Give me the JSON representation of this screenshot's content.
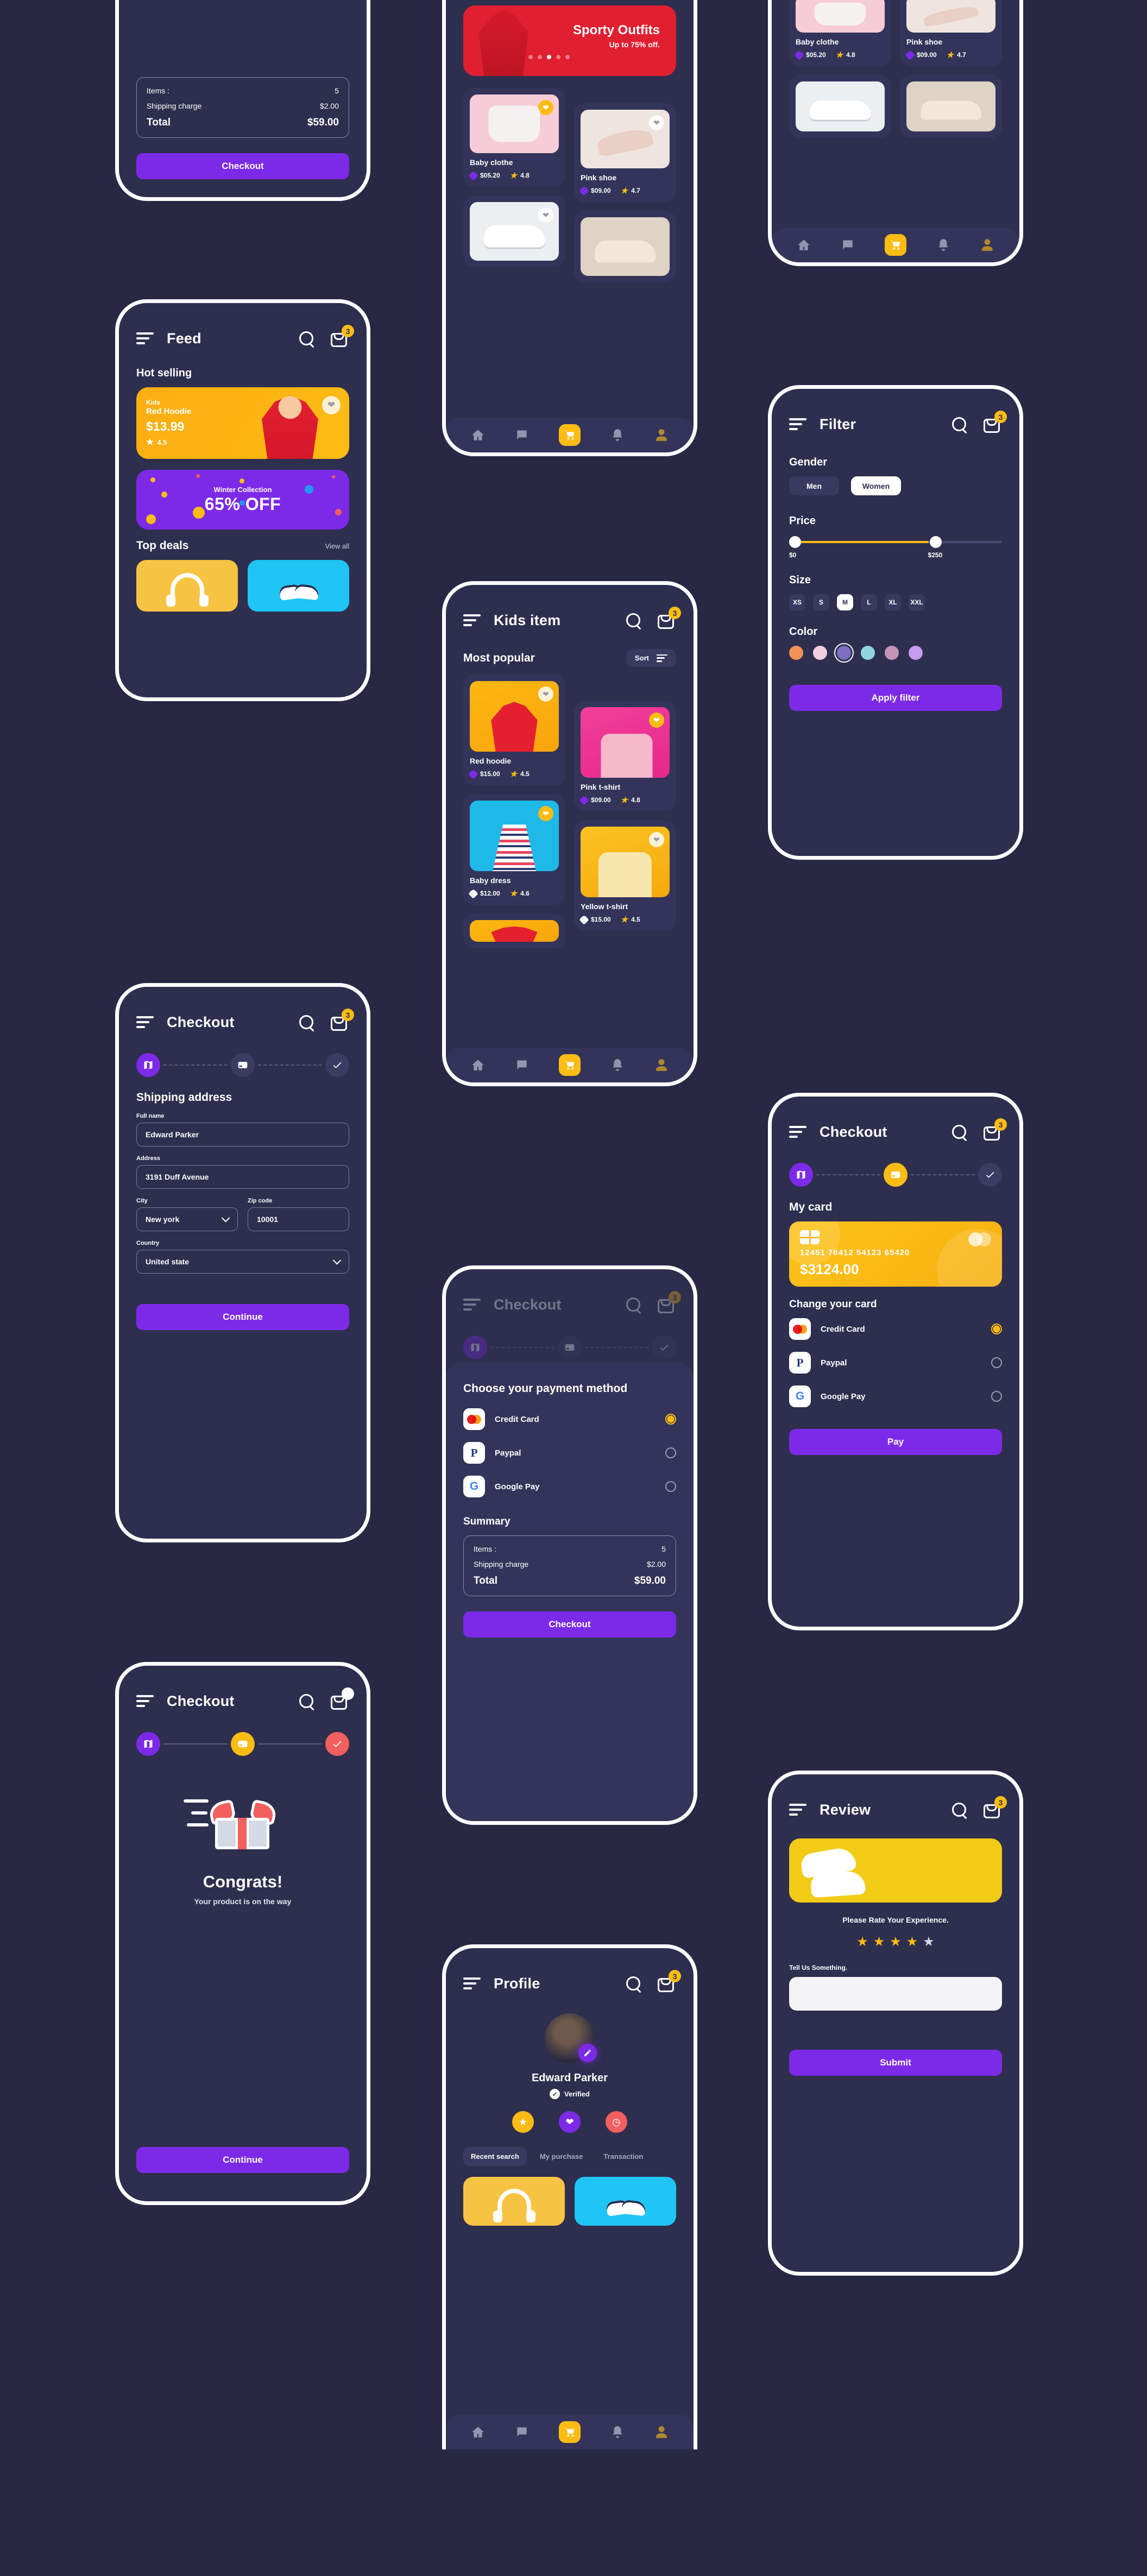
{
  "app": {
    "cart_badge": "3",
    "accent_purple": "#7c2ae8",
    "accent_yellow": "#fdbc14",
    "accent_red": "#f25f5f",
    "bg": "#282845",
    "surface": "#2e2e4f",
    "card": "#34345a"
  },
  "screens": {
    "cart_top": {
      "summary": {
        "rows": [
          {
            "label": "Items :",
            "value": "5"
          },
          {
            "label": "Shipping charge",
            "value": "$2.00"
          }
        ],
        "total_label": "Total",
        "total_value": "$59.00"
      },
      "checkout_button": "Checkout"
    },
    "feed": {
      "title": "Feed",
      "hot_selling_label": "Hot selling",
      "hero": {
        "eyebrow": "Kids",
        "name": "Red Hoodie",
        "price": "$13.99",
        "rating": "4.5"
      },
      "promo": {
        "title": "Winter Collection",
        "discount": "65% OFF"
      },
      "top_deals_label": "Top deals",
      "view_all": "View all"
    },
    "shop": {
      "banner": {
        "title": "Sporty Outfits",
        "subtitle": "Up to 75% off."
      },
      "products": [
        {
          "name": "Baby clothe",
          "price": "$05.20",
          "rating": "4.8"
        },
        {
          "name": "Pink shoe",
          "price": "$09.00",
          "rating": "4.7"
        }
      ]
    },
    "kids_item": {
      "title": "Kids item",
      "section_label": "Most popular",
      "sort_label": "Sort",
      "products": [
        {
          "name": "Red hoodie",
          "price": "$15.00",
          "rating": "4.5"
        },
        {
          "name": "Pink t-shirt",
          "price": "$09.00",
          "rating": "4.8"
        },
        {
          "name": "Baby dress",
          "price": "$12.00",
          "rating": "4.6"
        },
        {
          "name": "Yellow t-shirt",
          "price": "$15.00",
          "rating": "4.5"
        }
      ]
    },
    "filter": {
      "title": "Filter",
      "gender_label": "Gender",
      "gender_options": [
        "Men",
        "Women"
      ],
      "gender_selected": "Women",
      "price_label": "Price",
      "price_min": "$0",
      "price_max": "$250",
      "size_label": "Size",
      "sizes": [
        "XS",
        "S",
        "M",
        "L",
        "XL",
        "XXL"
      ],
      "size_selected": "M",
      "color_label": "Color",
      "colors": [
        "#f39255",
        "#f3cede",
        "#7e6fc0",
        "#8fd5e0",
        "#c295b6",
        "#c49bef"
      ],
      "color_selected_index": 2,
      "apply_button": "Apply filter"
    },
    "checkout_address": {
      "title": "Checkout",
      "section_label": "Shipping address",
      "fields": [
        {
          "label": "Full name",
          "value": "Edward Parker"
        },
        {
          "label": "Address",
          "value": "3191  Duff Avenue"
        },
        {
          "label": "City",
          "value": "New york"
        },
        {
          "label": "Zip code",
          "value": "10001"
        },
        {
          "label": "Country",
          "value": "United state"
        }
      ],
      "continue_button": "Continue"
    },
    "checkout_payment_sheet": {
      "title": "Checkout",
      "heading": "Choose your payment method",
      "methods": [
        {
          "name": "Credit Card",
          "selected": true
        },
        {
          "name": "Paypal",
          "selected": false
        },
        {
          "name": "Google Pay",
          "selected": false
        }
      ],
      "summary_label": "Summary",
      "summary_rows": [
        {
          "label": "Items :",
          "value": "5"
        },
        {
          "label": "Shipping charge",
          "value": "$2.00"
        }
      ],
      "total_label": "Total",
      "total_value": "$59.00",
      "checkout_button": "Checkout"
    },
    "checkout_card": {
      "title": "Checkout",
      "my_card_label": "My card",
      "card_number": "12451  78412  54123  65420",
      "card_amount": "$3124.00",
      "change_card_label": "Change your card",
      "methods": [
        {
          "name": "Credit Card",
          "selected": true
        },
        {
          "name": "Paypal",
          "selected": false
        },
        {
          "name": "Google Pay",
          "selected": false
        }
      ],
      "pay_button": "Pay"
    },
    "congrats": {
      "title": "Checkout",
      "heading": "Congrats!",
      "subtext": "Your product is on the way",
      "continue_button": "Continue"
    },
    "profile": {
      "title": "Profile",
      "name": "Edward Parker",
      "verified_label": "Verified",
      "tabs": [
        "Recent search",
        "My purchase",
        "Transaction"
      ],
      "tab_selected": "Recent search"
    },
    "review": {
      "title": "Review",
      "prompt": "Please Rate Your Experience.",
      "rating_filled": 4,
      "rating_total": 5,
      "tell_label": "Tell Us Something.",
      "submit_button": "Submit"
    }
  }
}
